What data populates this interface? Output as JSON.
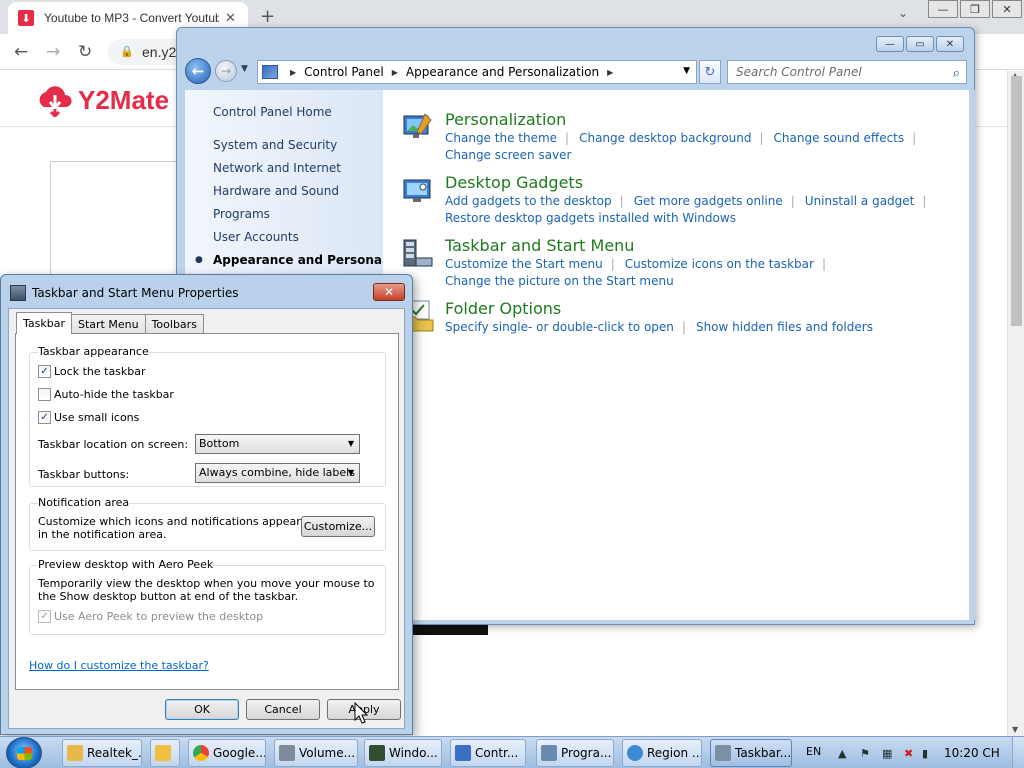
{
  "browser": {
    "tab_title": "Youtube to MP3 - Convert Youtube",
    "tab_close": "✕",
    "new_tab": "+",
    "address": "en.y2",
    "logo_text": "Y2Mate"
  },
  "control_panel": {
    "breadcrumb": [
      "Control Panel",
      "Appearance and Personalization"
    ],
    "search_placeholder": "Search Control Panel",
    "left_links": [
      "Control Panel Home",
      "System and Security",
      "Network and Internet",
      "Hardware and Sound",
      "Programs",
      "User Accounts",
      "Appearance and Personalization"
    ],
    "categories": [
      {
        "title": "Personalization",
        "rows": [
          [
            "Change the theme",
            "Change desktop background",
            "Change sound effects"
          ],
          [
            "Change screen saver"
          ]
        ]
      },
      {
        "title": "Desktop Gadgets",
        "rows": [
          [
            "Add gadgets to the desktop",
            "Get more gadgets online",
            "Uninstall a gadget"
          ],
          [
            "Restore desktop gadgets installed with Windows"
          ]
        ]
      },
      {
        "title": "Taskbar and Start Menu",
        "rows": [
          [
            "Customize the Start menu",
            "Customize icons on the taskbar"
          ],
          [
            "Change the picture on the Start menu"
          ]
        ]
      },
      {
        "title": "Folder Options",
        "rows": [
          [
            "Specify single- or double-click to open",
            "Show hidden files and folders"
          ]
        ]
      }
    ]
  },
  "dialog": {
    "title": "Taskbar and Start Menu Properties",
    "close": "✕",
    "tabs": [
      "Taskbar",
      "Start Menu",
      "Toolbars"
    ],
    "appearance": {
      "group_title": "Taskbar appearance",
      "lock_label": "Lock the taskbar",
      "lock_checked": "✓",
      "autohide_label": "Auto-hide the taskbar",
      "small_icons_label": "Use small icons",
      "small_icons_checked": "✓",
      "location_label": "Taskbar location on screen:",
      "location_value": "Bottom",
      "buttons_label": "Taskbar buttons:",
      "buttons_value": "Always combine, hide labels"
    },
    "notification": {
      "group_title": "Notification area",
      "description": "Customize which icons and notifications appear in the notification area.",
      "customize_button": "Customize..."
    },
    "aero_peek": {
      "group_title": "Preview desktop with Aero Peek",
      "description": "Temporarily view the desktop when you move your mouse to the Show desktop button at end of the taskbar.",
      "checkbox_label": "Use Aero Peek to preview the desktop",
      "checked": "✓"
    },
    "help_link": "How do I customize the taskbar?",
    "ok": "OK",
    "cancel": "Cancel",
    "apply": "Apply"
  },
  "taskbar": {
    "buttons": [
      {
        "label": "Realtek_...",
        "color": "#e8b84a"
      },
      {
        "label": "",
        "color": "#f0c040"
      },
      {
        "label": "Google...",
        "color": "#4285f4"
      },
      {
        "label": "Volume...",
        "color": "#7d8a99"
      },
      {
        "label": "Windo...",
        "color": "#2f4f2f"
      },
      {
        "label": "Contr...",
        "color": "#3a6fc3"
      },
      {
        "label": "Progra...",
        "color": "#6a8ab0"
      },
      {
        "label": "Region ...",
        "color": "#3b8ad6"
      },
      {
        "label": "Taskbar...",
        "color": "#7b8fa5"
      }
    ],
    "lang": "EN",
    "clock": "10:20 CH"
  }
}
